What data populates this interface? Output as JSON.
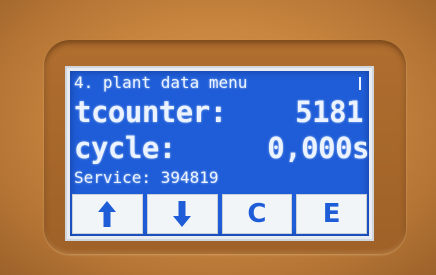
{
  "display": {
    "header": "4. plant data menu",
    "rows": [
      {
        "label": "tcounter:",
        "value": "5181"
      },
      {
        "label": "cycle:",
        "value": "0,000s"
      }
    ],
    "service": "Service: 394819"
  },
  "softkeys": [
    {
      "icon": "arrow-up-icon"
    },
    {
      "icon": "arrow-down-icon"
    },
    {
      "label": "C"
    },
    {
      "label": "E"
    }
  ],
  "colors": {
    "housing": "#c98a45",
    "lcd_background": "#1f5dd8",
    "lcd_text": "#eaf3ff",
    "key_face": "#f2f5f8",
    "key_text": "#1f5dd8"
  }
}
